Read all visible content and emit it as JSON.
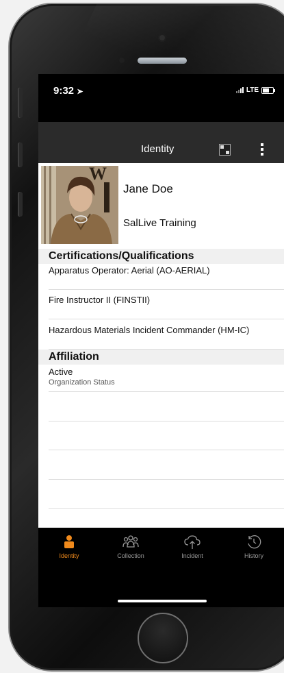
{
  "status_bar": {
    "time": "9:32",
    "network": "LTE"
  },
  "header": {
    "title": "Identity"
  },
  "profile": {
    "name": "Jane Doe",
    "organization": "SalLive Training"
  },
  "certifications": {
    "heading": "Certifications/Qualifications",
    "items": [
      "Apparatus Operator: Aerial (AO-AERIAL)",
      "Fire Instructor II (FINSTII)",
      "Hazardous Materials Incident Commander (HM-IC)"
    ]
  },
  "affiliation": {
    "heading": "Affiliation",
    "status_value": "Active",
    "status_label": "Organization Status"
  },
  "tabs": [
    {
      "label": "Identity",
      "icon": "person-icon",
      "active": true
    },
    {
      "label": "Collection",
      "icon": "group-icon",
      "active": false
    },
    {
      "label": "Incident",
      "icon": "cloud-upload-icon",
      "active": false
    },
    {
      "label": "History",
      "icon": "history-clock-icon",
      "active": false
    }
  ],
  "colors": {
    "accent": "#f08a1c",
    "header_bg": "#2b2b2b",
    "section_bg": "#f0f0f0"
  }
}
